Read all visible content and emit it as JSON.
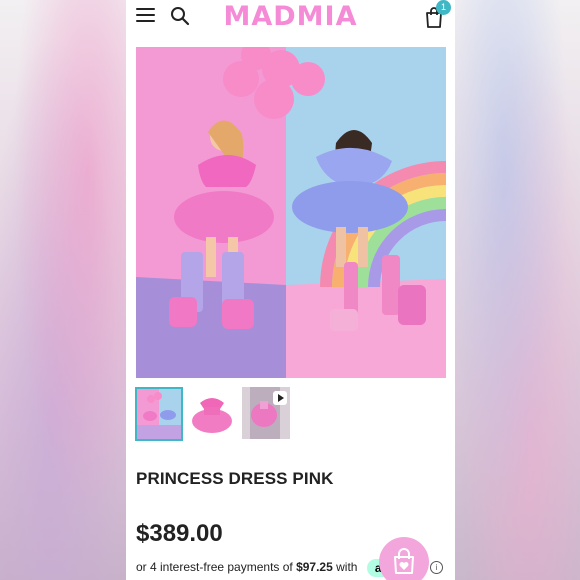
{
  "header": {
    "logo": "MADMIA",
    "cart_count": "1"
  },
  "main_image": {
    "subject": "two girls in sequin princess dresses with balloons and rainbow backdrop"
  },
  "thumbnails": [
    {
      "name": "thumbnail-girls-photo",
      "active": true
    },
    {
      "name": "thumbnail-pink-dress",
      "active": false
    },
    {
      "name": "thumbnail-video",
      "active": false
    }
  ],
  "product": {
    "title": "PRINCESS DRESS PINK",
    "price": "$389.00",
    "installments_prefix": "or 4 interest-free payments of ",
    "installment_amount": "$97.25",
    "installments_suffix": " with",
    "afterpay_label": "afterpay"
  },
  "colors": {
    "brand_pink": "#f58bd6",
    "accent_teal": "#3fb8c6",
    "afterpay_mint": "#b2fce4"
  }
}
